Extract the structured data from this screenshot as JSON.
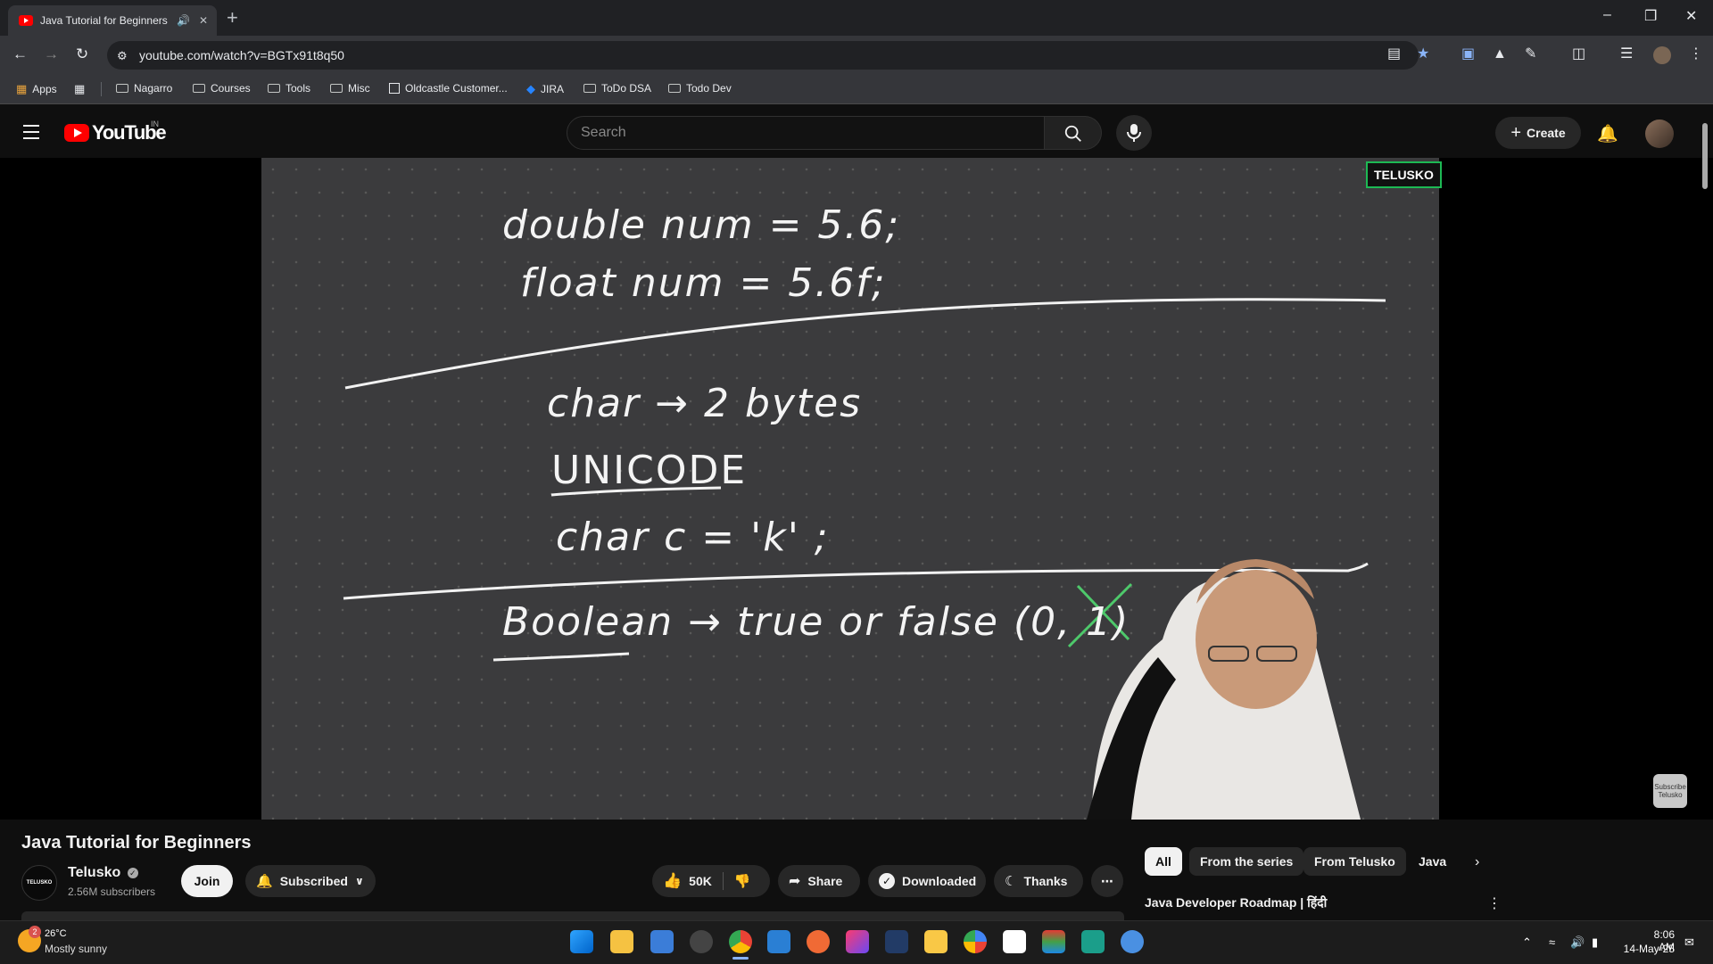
{
  "browser": {
    "tab_title": "Java Tutorial for Beginners",
    "url": "youtube.com/watch?v=BGTx91t8q50",
    "bookmarks": [
      "Apps",
      "Nagarro",
      "Courses",
      "Tools",
      "Misc",
      "Oldcastle Customer...",
      "JIRA",
      "ToDo DSA",
      "Todo Dev"
    ]
  },
  "youtube": {
    "logo_text": "YouTube",
    "country": "IN",
    "search_placeholder": "Search",
    "create_label": "Create"
  },
  "video": {
    "watermark": "TELUSKO",
    "board_lines": [
      "double  num = 5.6;",
      "float  num = 5.6f;",
      "char  →  2 bytes",
      "UNICODE",
      "char  c = 'k' ;",
      "Boolean  →  true or false  (0, 1)"
    ],
    "subscribe_badge": "Subscribe Telusko"
  },
  "details": {
    "title": "Java Tutorial for Beginners",
    "channel_name": "Telusko",
    "channel_logo_text": "TELUSKO",
    "subscribers": "2.56M subscribers",
    "join_label": "Join",
    "subscribed_label": "Subscribed",
    "likes": "50K",
    "share_label": "Share",
    "downloaded_label": "Downloaded",
    "thanks_label": "Thanks"
  },
  "sidebar": {
    "chips": [
      "All",
      "From the series",
      "From Telusko",
      "Java"
    ],
    "next_video_title": "Java Developer Roadmap | हिंदी"
  },
  "taskbar": {
    "weather_temp": "26°C",
    "weather_text": "Mostly sunny",
    "weather_badge": "2",
    "time": "8:06 AM",
    "date": "14-May-25"
  },
  "colors": {
    "youtube_red": "#ff0000",
    "watermark_border": "#1db954",
    "page_bg": "#0f0f0f"
  }
}
